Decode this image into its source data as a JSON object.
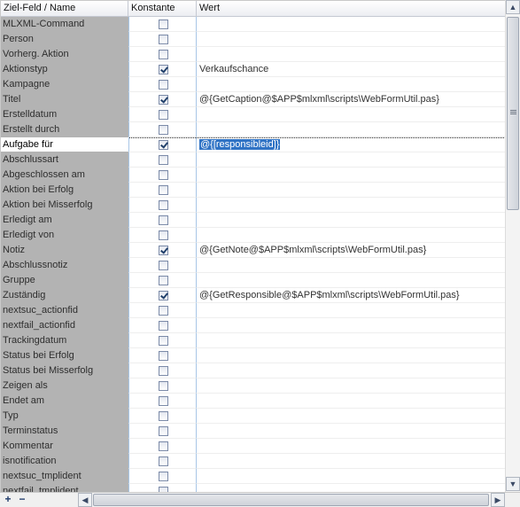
{
  "columns": {
    "name": "Ziel-Feld / Name",
    "constant": "Konstante",
    "value": "Wert"
  },
  "rows": [
    {
      "name": "MLXML-Command",
      "checked": false,
      "value": ""
    },
    {
      "name": "Person",
      "checked": false,
      "value": ""
    },
    {
      "name": "Vorherg. Aktion",
      "checked": false,
      "value": ""
    },
    {
      "name": "Aktionstyp",
      "checked": true,
      "value": "Verkaufschance"
    },
    {
      "name": "Kampagne",
      "checked": false,
      "value": ""
    },
    {
      "name": "Titel",
      "checked": true,
      "value": "@{GetCaption@$APP$mlxml\\scripts\\WebFormUtil.pas}"
    },
    {
      "name": "Erstelldatum",
      "checked": false,
      "value": ""
    },
    {
      "name": "Erstellt durch",
      "checked": false,
      "value": ""
    },
    {
      "name": "Aufgabe für",
      "checked": true,
      "value": "@{[responsibleid]}",
      "selected": true
    },
    {
      "name": "Abschlussart",
      "checked": false,
      "value": ""
    },
    {
      "name": "Abgeschlossen am",
      "checked": false,
      "value": ""
    },
    {
      "name": "Aktion bei Erfolg",
      "checked": false,
      "value": ""
    },
    {
      "name": "Aktion bei Misserfolg",
      "checked": false,
      "value": ""
    },
    {
      "name": "Erledigt am",
      "checked": false,
      "value": ""
    },
    {
      "name": "Erledigt von",
      "checked": false,
      "value": ""
    },
    {
      "name": "Notiz",
      "checked": true,
      "value": "@{GetNote@$APP$mlxml\\scripts\\WebFormUtil.pas}"
    },
    {
      "name": "Abschlussnotiz",
      "checked": false,
      "value": ""
    },
    {
      "name": "Gruppe",
      "checked": false,
      "value": ""
    },
    {
      "name": "Zuständig",
      "checked": true,
      "value": "@{GetResponsible@$APP$mlxml\\scripts\\WebFormUtil.pas}"
    },
    {
      "name": "nextsuc_actionfid",
      "checked": false,
      "value": ""
    },
    {
      "name": "nextfail_actionfid",
      "checked": false,
      "value": ""
    },
    {
      "name": "Trackingdatum",
      "checked": false,
      "value": ""
    },
    {
      "name": "Status bei Erfolg",
      "checked": false,
      "value": ""
    },
    {
      "name": "Status bei Misserfolg",
      "checked": false,
      "value": ""
    },
    {
      "name": "Zeigen als",
      "checked": false,
      "value": ""
    },
    {
      "name": "Endet am",
      "checked": false,
      "value": ""
    },
    {
      "name": "Typ",
      "checked": false,
      "value": ""
    },
    {
      "name": "Terminstatus",
      "checked": false,
      "value": ""
    },
    {
      "name": "Kommentar",
      "checked": false,
      "value": ""
    },
    {
      "name": "isnotification",
      "checked": false,
      "value": ""
    },
    {
      "name": "nextsuc_tmplident",
      "checked": false,
      "value": ""
    },
    {
      "name": "nextfail_tmplident",
      "checked": false,
      "value": ""
    }
  ],
  "toolbar": {
    "add_label": "+",
    "remove_label": "−"
  },
  "scroll": {
    "up": "▲",
    "down": "▼",
    "left": "◀",
    "right": "▶"
  }
}
